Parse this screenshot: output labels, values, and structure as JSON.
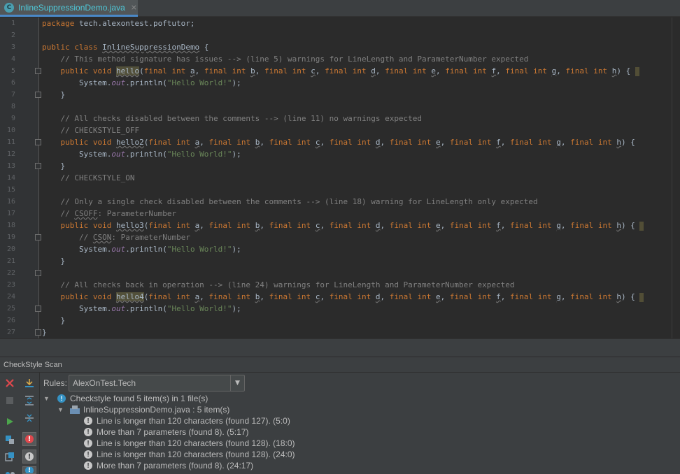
{
  "tab": {
    "file_name": "InlineSuppressionDemo.java",
    "close_glyph": "×",
    "icon_letter": "C"
  },
  "editor": {
    "line_numbers": [
      "1",
      "2",
      "3",
      "4",
      "5",
      "6",
      "7",
      "8",
      "9",
      "10",
      "11",
      "12",
      "13",
      "14",
      "15",
      "16",
      "17",
      "18",
      "19",
      "20",
      "21",
      "22",
      "23",
      "24",
      "25",
      "26",
      "27"
    ]
  },
  "panel": {
    "title": "CheckStyle Scan",
    "rules_label": "Rules:",
    "rules_value": "AlexOnTest.Tech",
    "summary": "Checkstyle found 5 item(s) in 1 file(s)",
    "file_node": "InlineSuppressionDemo.java : 5 item(s)",
    "items": [
      "Line is longer than 120 characters (found 127). (5:0)",
      "More than 7 parameters (found 8). (5:17)",
      "Line is longer than 120 characters (found 128). (18:0)",
      "Line is longer than 120 characters (found 128). (24:0)",
      "More than 7 parameters (found 8). (24:17)"
    ]
  },
  "colors": {
    "keyword": "#cc7832",
    "comment": "#808080",
    "string": "#6a8759",
    "field": "#9876aa",
    "accent": "#4a88c7"
  }
}
